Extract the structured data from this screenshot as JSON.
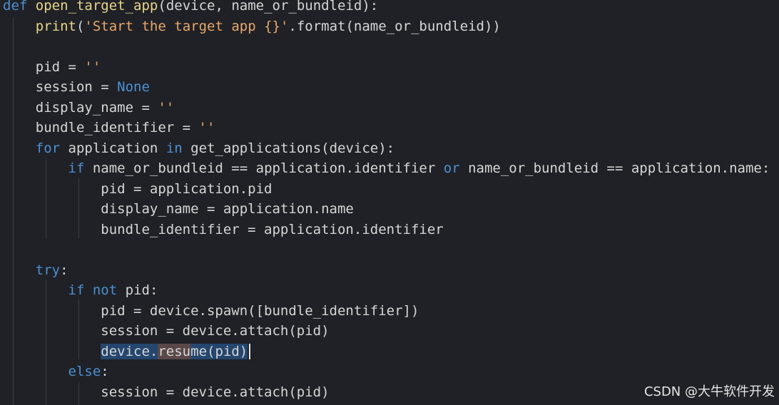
{
  "lines": [
    [
      [
        "kw",
        "def"
      ],
      [
        "id",
        " "
      ],
      [
        "fn",
        "open_target_app"
      ],
      [
        "id",
        "(device, name_or_bundleid):"
      ]
    ],
    [
      [
        "id",
        "    "
      ],
      [
        "fn",
        "print"
      ],
      [
        "id",
        "("
      ],
      [
        "str",
        "'Start the target app {}'"
      ],
      [
        "id",
        ".format(name_or_bundleid))"
      ]
    ],
    [],
    [
      [
        "id",
        "    pid = "
      ],
      [
        "str",
        "''"
      ]
    ],
    [
      [
        "id",
        "    session = "
      ],
      [
        "kw",
        "None"
      ]
    ],
    [
      [
        "id",
        "    display_name = "
      ],
      [
        "str",
        "''"
      ]
    ],
    [
      [
        "id",
        "    bundle_identifier = "
      ],
      [
        "str",
        "''"
      ]
    ],
    [
      [
        "id",
        "    "
      ],
      [
        "kw",
        "for"
      ],
      [
        "id",
        " application "
      ],
      [
        "kw",
        "in"
      ],
      [
        "id",
        " get_applications(device):"
      ]
    ],
    [
      [
        "id",
        "        "
      ],
      [
        "kw",
        "if"
      ],
      [
        "id",
        " name_or_bundleid == application.identifier "
      ],
      [
        "kw",
        "or"
      ],
      [
        "id",
        " name_or_bundleid == application.name:"
      ]
    ],
    [
      [
        "id",
        "            pid = application.pid"
      ]
    ],
    [
      [
        "id",
        "            display_name = application.name"
      ]
    ],
    [
      [
        "id",
        "            bundle_identifier = application.identifier"
      ]
    ],
    [],
    [
      [
        "id",
        "    "
      ],
      [
        "kw",
        "try"
      ],
      [
        "id",
        ":"
      ]
    ],
    [
      [
        "id",
        "        "
      ],
      [
        "kw",
        "if"
      ],
      [
        "id",
        " "
      ],
      [
        "kw",
        "not"
      ],
      [
        "id",
        " pid:"
      ]
    ],
    [
      [
        "id",
        "            pid = device.spawn([bundle_identifier])"
      ]
    ],
    [
      [
        "id",
        "            session = device.attach(pid)"
      ]
    ],
    [
      [
        "id",
        "            "
      ],
      [
        "hl",
        "device."
      ],
      [
        "hl2",
        "resu"
      ],
      [
        "hl",
        "me(pid)"
      ],
      [
        "caret",
        ""
      ]
    ],
    [
      [
        "id",
        "        "
      ],
      [
        "kw",
        "else"
      ],
      [
        "id",
        ":"
      ]
    ],
    [
      [
        "id",
        "            session = device.attach(pid)"
      ]
    ]
  ],
  "watermark": "CSDN @大牛软件开发",
  "colors": {
    "background": "#1f2126",
    "keyword": "#4d8fd1",
    "function": "#e8d58a",
    "string": "#e8a86a",
    "text": "#d6d6d6",
    "selection": "#25466e"
  }
}
